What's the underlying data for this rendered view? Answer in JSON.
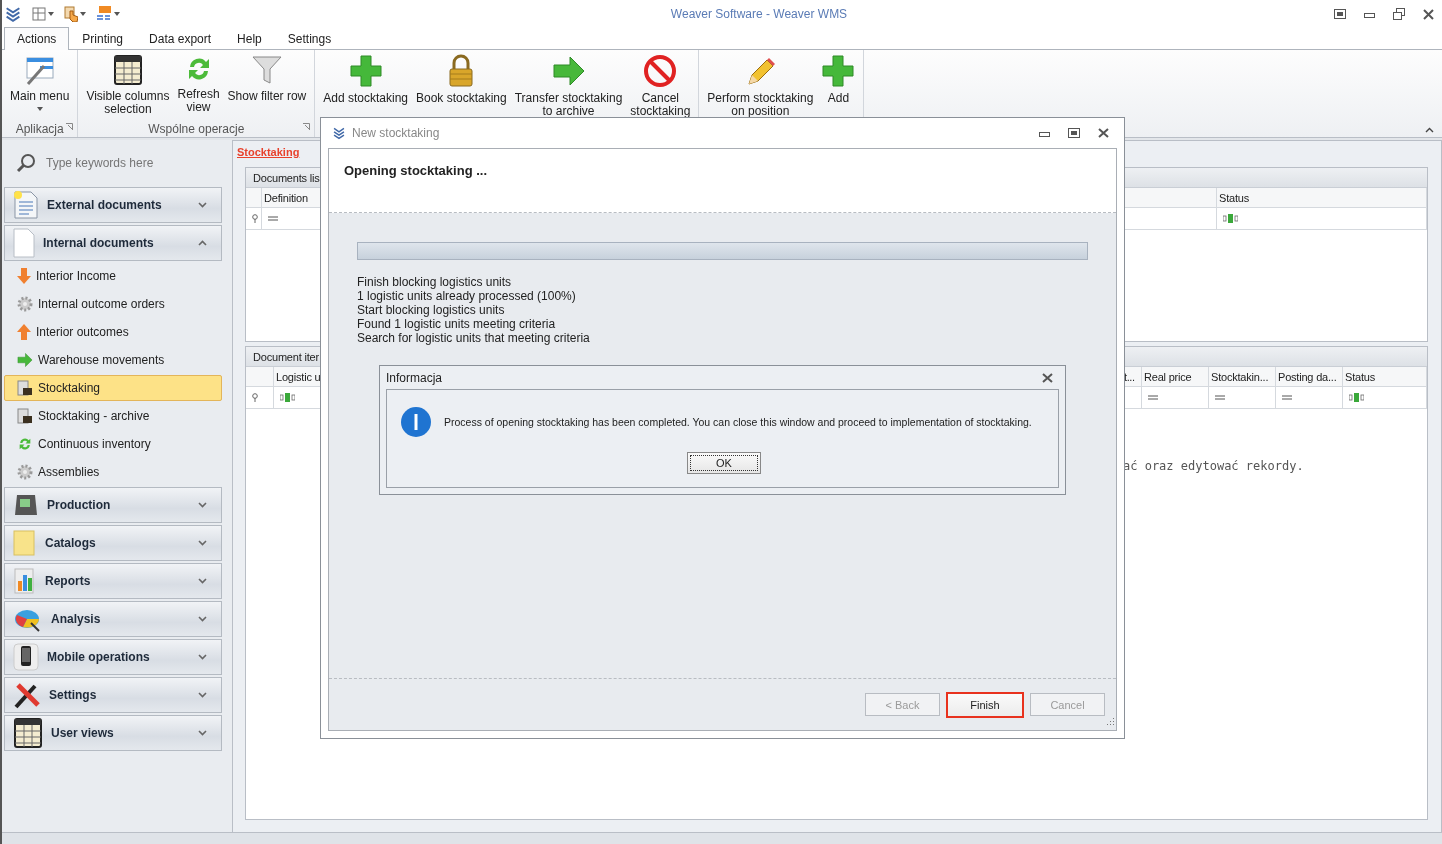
{
  "window": {
    "title": "Weaver Software - Weaver WMS"
  },
  "ribbon": {
    "tabs": [
      {
        "label": "Actions",
        "selected": true
      },
      {
        "label": "Printing",
        "selected": false
      },
      {
        "label": "Data export",
        "selected": false
      },
      {
        "label": "Help",
        "selected": false
      },
      {
        "label": "Settings",
        "selected": false
      }
    ],
    "groups": [
      {
        "label": "Aplikacja",
        "buttons": [
          {
            "label": "Main menu",
            "dropdown": true
          }
        ]
      },
      {
        "label": "Wspólne operacje",
        "buttons": [
          {
            "label": "Visible columns\nselection"
          },
          {
            "label": "Refresh\nview"
          },
          {
            "label": "Show filter row"
          }
        ]
      },
      {
        "buttons": [
          {
            "label": "Add stocktaking"
          },
          {
            "label": "Book stocktaking"
          },
          {
            "label": "Transfer stocktaking\nto archive"
          },
          {
            "label": "Cancel\nstocktaking"
          }
        ]
      },
      {
        "buttons": [
          {
            "label": "Perform stocktaking\non position"
          },
          {
            "label": "Add"
          }
        ]
      }
    ]
  },
  "sidebar": {
    "search": {
      "placeholder": "Type keywords here"
    },
    "groups": [
      {
        "label": "External documents",
        "expanded": false
      },
      {
        "label": "Internal documents",
        "expanded": true,
        "children": [
          {
            "label": "Interior Income",
            "selected": false
          },
          {
            "label": "Internal outcome orders",
            "selected": false
          },
          {
            "label": "Interior outcomes",
            "selected": false
          },
          {
            "label": "Warehouse movements",
            "selected": false
          },
          {
            "label": "Stocktaking",
            "selected": true
          },
          {
            "label": "Stocktaking - archive",
            "selected": false
          },
          {
            "label": "Continuous inventory",
            "selected": false
          },
          {
            "label": "Assemblies",
            "selected": false
          }
        ]
      },
      {
        "label": "Production",
        "expanded": false
      },
      {
        "label": "Catalogs",
        "expanded": false
      },
      {
        "label": "Reports",
        "expanded": false
      },
      {
        "label": "Analysis",
        "expanded": false
      },
      {
        "label": "Mobile operations",
        "expanded": false
      },
      {
        "label": "Settings",
        "expanded": false
      },
      {
        "label": "User views",
        "expanded": false
      }
    ]
  },
  "content": {
    "breadcrumb": "Stocktaking",
    "documents_list": {
      "title": "Documents lis",
      "columns": [
        {
          "label": "Definition",
          "filter": {
            "kind": "equals"
          }
        },
        {
          "label": "Status",
          "filter": {
            "kind": "text"
          }
        }
      ]
    },
    "document_items": {
      "title": "Document iter",
      "columns": [
        {
          "label": "Logistic u",
          "filter": {
            "kind": "text"
          }
        },
        {
          "label": "t..."
        },
        {
          "label": "Real price",
          "filter": {
            "kind": "equals"
          }
        },
        {
          "label": "Stocktakin...",
          "filter": {
            "kind": "equals"
          }
        },
        {
          "label": "Posting da...",
          "filter": {
            "kind": "equals"
          }
        },
        {
          "label": "Status",
          "filter": {
            "kind": "text"
          }
        }
      ],
      "message": "ać oraz edytować rekordy."
    }
  },
  "wizard": {
    "title": "New stocktaking",
    "heading": "Opening stocktaking ...",
    "progress": {
      "level": 1
    },
    "log": [
      "Finish blocking logistics units",
      "1 logistic units already processed (100%)",
      "Start blocking logistics units",
      "Found 1 logistic units meeting criteria",
      "Search for logistic units that meeting criteria"
    ],
    "message_box": {
      "title": "Informacja",
      "text": "Process of opening stocktaking has been completed. You can close this window and proceed to implementation of stocktaking.",
      "button": "OK"
    },
    "buttons": [
      {
        "label": "< Back",
        "disabled": true,
        "highlighted": false
      },
      {
        "label": "Finish",
        "disabled": false,
        "highlighted": true
      },
      {
        "label": "Cancel",
        "disabled": true,
        "highlighted": false
      }
    ]
  }
}
